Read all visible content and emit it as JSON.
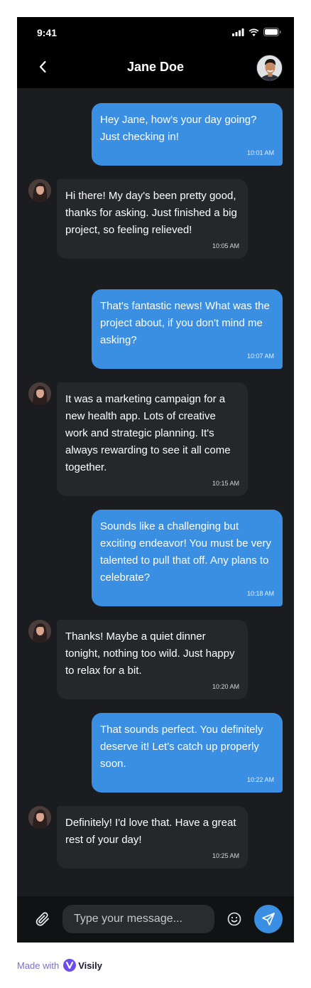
{
  "status_bar": {
    "time": "9:41"
  },
  "header": {
    "title": "Jane Doe"
  },
  "messages": [
    {
      "type": "sent",
      "text": "Hey Jane, how's your day going? Just checking in!",
      "time": "10:01 AM"
    },
    {
      "type": "received",
      "text": "Hi there! My day's been pretty good, thanks for asking. Just finished a big project, so feeling relieved!",
      "time": "10:05 AM"
    },
    {
      "type": "sent",
      "text": "That's fantastic news! What was the project about, if you don't mind me asking?",
      "time": "10:07 AM"
    },
    {
      "type": "received",
      "text": "It was a marketing campaign for a new health app. Lots of creative work and strategic planning. It's always rewarding to see it all come together.",
      "time": "10:15 AM"
    },
    {
      "type": "sent",
      "text": "Sounds like a challenging but exciting endeavor! You must be very talented to pull that off. Any plans to celebrate?",
      "time": "10:18 AM"
    },
    {
      "type": "received",
      "text": "Thanks! Maybe a quiet dinner tonight, nothing too wild. Just happy to relax for a bit.",
      "time": "10:20 AM"
    },
    {
      "type": "sent",
      "text": "That sounds perfect. You definitely deserve it! Let's catch up properly soon.",
      "time": "10:22 AM"
    },
    {
      "type": "received",
      "text": "Definitely! I'd love that. Have a great rest of your day!",
      "time": "10:25 AM"
    }
  ],
  "composer": {
    "placeholder": "Type your message..."
  },
  "footer": {
    "made_with": "Made with",
    "brand": "Visily"
  },
  "colors": {
    "sent_bubble": "#3a8fe3",
    "received_bubble": "#26272b",
    "background": "#1b1c1f",
    "header": "#000000"
  },
  "icons": {
    "back": "chevron-left-icon",
    "attach": "paperclip-icon",
    "emoji": "smiley-icon",
    "send": "send-icon"
  }
}
